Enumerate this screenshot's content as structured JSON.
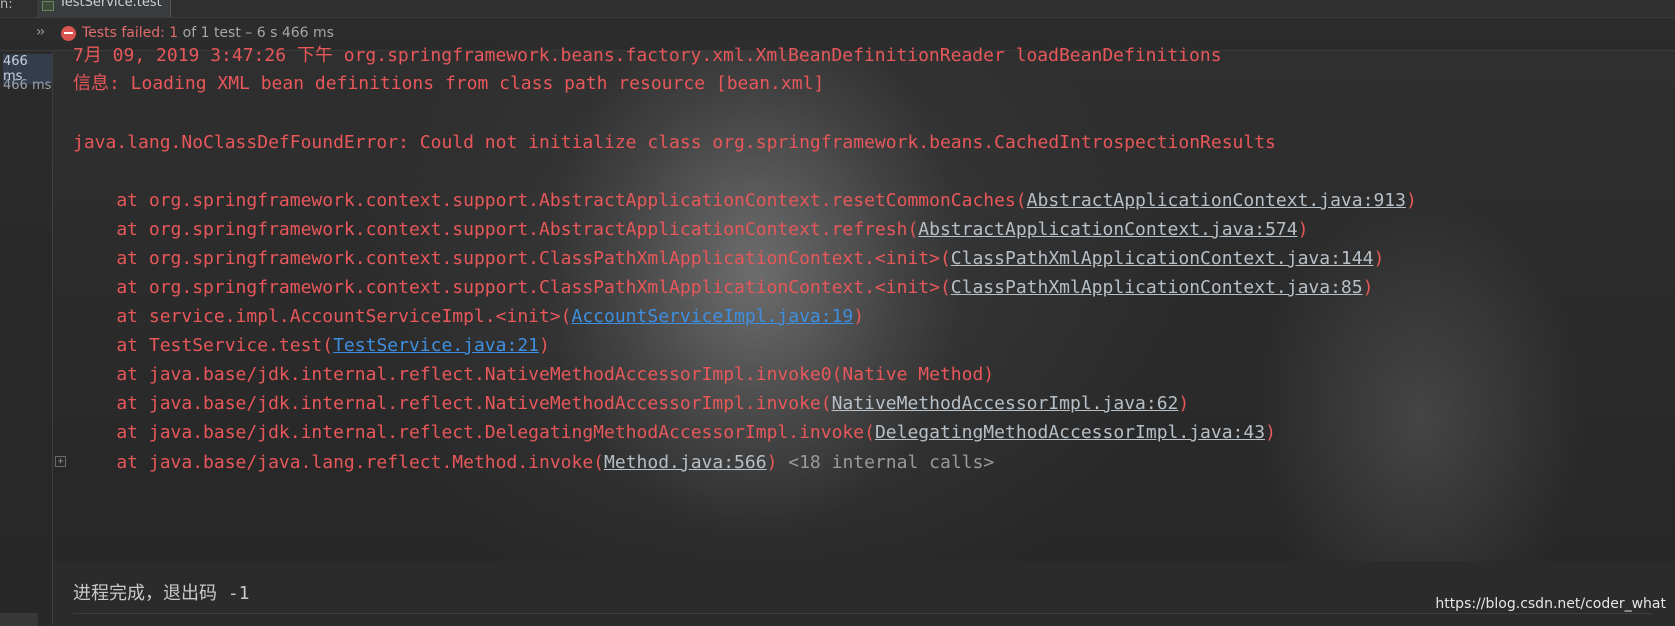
{
  "topbar": {
    "run_label": "n:",
    "tab_label": "TestService.test"
  },
  "status": {
    "failed_text": "Tests failed: 1",
    "rest_text": " of 1 test – 6 s 466 ms"
  },
  "gutter": {
    "times": [
      "466 ms",
      "466 ms"
    ]
  },
  "console": {
    "lines": [
      {
        "segments": [
          {
            "text": "7月 09, 2019 3:47:26 下午 org.springframework.beans.factory.xml.XmlBeanDefinitionReader loadBeanDefinitions",
            "kind": "text"
          }
        ]
      },
      {
        "segments": [
          {
            "text": "信息: Loading XML bean definitions from class path resource [bean.xml]",
            "kind": "text"
          }
        ]
      },
      {
        "segments": [
          {
            "text": "java.lang.NoClassDefFoundError: Could not initialize class org.springframework.beans.CachedIntrospectionResults",
            "kind": "text"
          }
        ]
      },
      {
        "segments": [
          {
            "text": "    at org.springframework.context.support.AbstractApplicationContext.resetCommonCaches(",
            "kind": "text"
          },
          {
            "text": "AbstractApplicationContext.java:913",
            "kind": "link"
          },
          {
            "text": ")",
            "kind": "text"
          }
        ]
      },
      {
        "segments": [
          {
            "text": "    at org.springframework.context.support.AbstractApplicationContext.refresh(",
            "kind": "text"
          },
          {
            "text": "AbstractApplicationContext.java:574",
            "kind": "link"
          },
          {
            "text": ")",
            "kind": "text"
          }
        ]
      },
      {
        "segments": [
          {
            "text": "    at org.springframework.context.support.ClassPathXmlApplicationContext.<init>(",
            "kind": "text"
          },
          {
            "text": "ClassPathXmlApplicationContext.java:144",
            "kind": "link"
          },
          {
            "text": ")",
            "kind": "text"
          }
        ]
      },
      {
        "segments": [
          {
            "text": "    at org.springframework.context.support.ClassPathXmlApplicationContext.<init>(",
            "kind": "text"
          },
          {
            "text": "ClassPathXmlApplicationContext.java:85",
            "kind": "link"
          },
          {
            "text": ")",
            "kind": "text"
          }
        ]
      },
      {
        "segments": [
          {
            "text": "    at service.impl.AccountServiceImpl.<init>(",
            "kind": "text"
          },
          {
            "text": "AccountServiceImpl.java:19",
            "kind": "link-blue"
          },
          {
            "text": ")",
            "kind": "text"
          }
        ]
      },
      {
        "segments": [
          {
            "text": "    at TestService.test(",
            "kind": "text"
          },
          {
            "text": "TestService.java:21",
            "kind": "link-blue"
          },
          {
            "text": ")",
            "kind": "text"
          }
        ]
      },
      {
        "segments": [
          {
            "text": "    at java.base/jdk.internal.reflect.NativeMethodAccessorImpl.invoke0(Native Method)",
            "kind": "text"
          }
        ]
      },
      {
        "segments": [
          {
            "text": "    at java.base/jdk.internal.reflect.NativeMethodAccessorImpl.invoke(",
            "kind": "text"
          },
          {
            "text": "NativeMethodAccessorImpl.java:62",
            "kind": "link"
          },
          {
            "text": ")",
            "kind": "text"
          }
        ]
      },
      {
        "segments": [
          {
            "text": "    at java.base/jdk.internal.reflect.DelegatingMethodAccessorImpl.invoke(",
            "kind": "text"
          },
          {
            "text": "DelegatingMethodAccessorImpl.java:43",
            "kind": "link"
          },
          {
            "text": ")",
            "kind": "text"
          }
        ]
      },
      {
        "segments": [
          {
            "text": "    at java.base/java.lang.reflect.Method.invoke(",
            "kind": "text"
          },
          {
            "text": "Method.java:566",
            "kind": "link"
          },
          {
            "text": ")",
            "kind": "text"
          },
          {
            "text": " <18 internal calls>",
            "kind": "gray"
          }
        ]
      }
    ],
    "exit_text": "进程完成，退出码 -1"
  },
  "watermark": "https://blog.csdn.net/coder_what",
  "colors": {
    "error_text": "#e8575a",
    "link_gray": "#b7bfc7",
    "link_blue": "#3f8fe0",
    "fail_badge": "#d9534f"
  },
  "icons": {
    "tab": "test-file-icon",
    "expand": "double-chevron-right-icon",
    "status": "minus-circle-fail-icon",
    "fold": "plus-square-icon"
  }
}
